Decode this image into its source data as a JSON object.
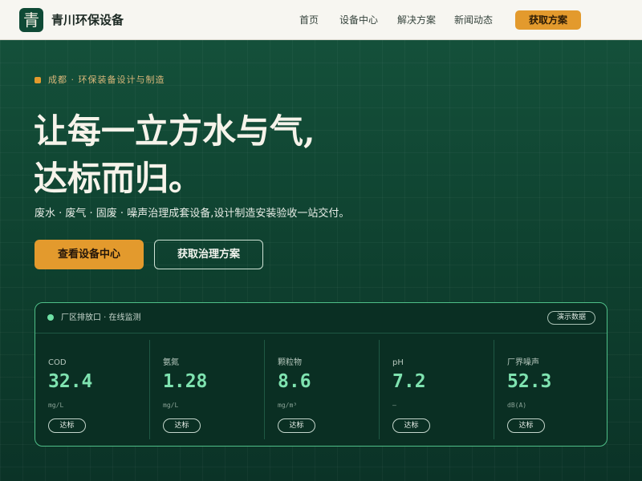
{
  "header": {
    "logo_char": "青",
    "brand": "青川环保设备",
    "nav": [
      "首页",
      "设备中心",
      "解决方案",
      "新闻动态"
    ],
    "cta": "获取方案"
  },
  "hero": {
    "tag": "成都 · 环保装备设计与制造",
    "headline_line1": "让每一立方水与气,",
    "headline_line2": "达标而归。",
    "subtitle": "废水 · 废气 · 固废 · 噪声治理成套设备,设计制造安装验收一站交付。",
    "primary_button": "查看设备中心",
    "secondary_button": "获取治理方案"
  },
  "monitor": {
    "title": "厂区排放口 · 在线监测",
    "badge": "演示数据",
    "metrics": [
      {
        "label": "COD",
        "value": "32.4",
        "unit": "mg/L",
        "status": "达标"
      },
      {
        "label": "氨氮",
        "value": "1.28",
        "unit": "mg/L",
        "status": "达标"
      },
      {
        "label": "颗粒物",
        "value": "8.6",
        "unit": "mg/m³",
        "status": "达标"
      },
      {
        "label": "pH",
        "value": "7.2",
        "unit": "—",
        "status": "达标"
      },
      {
        "label": "厂界噪声",
        "value": "52.3",
        "unit": "dB(A)",
        "status": "达标"
      }
    ]
  },
  "colors": {
    "accent": "#e39a2d",
    "brand_green": "#0f4a36",
    "metric_value": "#7fe3b0",
    "panel_border": "#4fbf88"
  }
}
